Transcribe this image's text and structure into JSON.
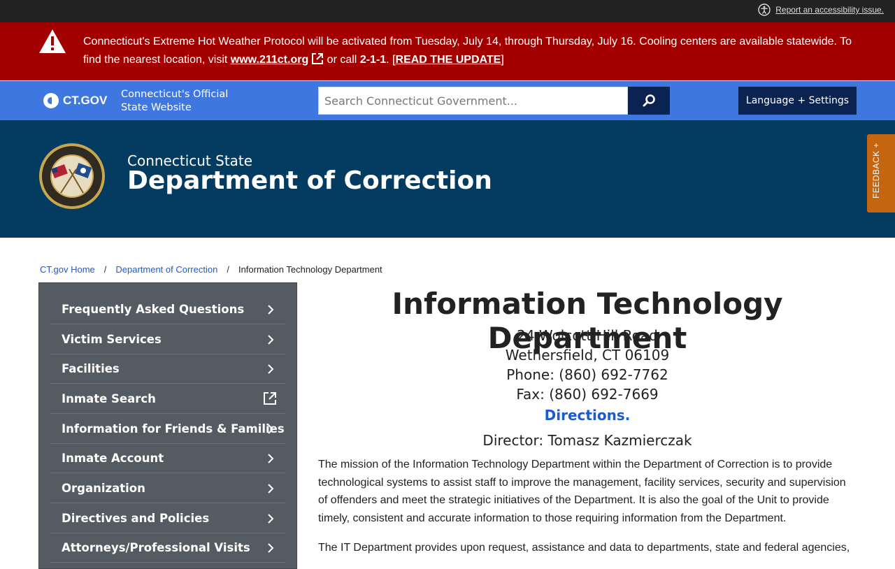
{
  "topbar": {
    "accessibility_link": "Report an accessibility issue."
  },
  "alert": {
    "text_before": "Connecticut's Extreme Hot Weather Protocol will be activated from Tuesday, July 14, through Thursday, July 16. Cooling centers are available statewide. To find the nearest location, visit ",
    "link": "www.211ct.org",
    "text_middle": " or call ",
    "phone": "2-1-1",
    "text_after": ". [",
    "update_link": "READ THE UPDATE",
    "text_end": "]"
  },
  "ctbar": {
    "logo": "CT.GOV",
    "official_line1": "Connecticut's Official",
    "official_line2": "State Website",
    "search_placeholder": "Search Connecticut Government...",
    "language_button": "Language + Settings"
  },
  "hero": {
    "subtitle": "Connecticut State",
    "title": "Department of Correction"
  },
  "feedback": "FEEDBACK +",
  "breadcrumb": [
    "CT.gov Home",
    "Department of Correction",
    "Information Technology Department"
  ],
  "sidenav": {
    "items": [
      {
        "label": "Frequently Asked Questions",
        "icon": "chevron-right-icon"
      },
      {
        "label": "Victim Services",
        "icon": "chevron-right-icon"
      },
      {
        "label": "Facilities",
        "icon": "chevron-right-icon"
      },
      {
        "label": "Inmate Search",
        "icon": "external-link-icon"
      },
      {
        "label": "Information for Friends & Families",
        "icon": "chevron-right-icon"
      },
      {
        "label": "Inmate Account",
        "icon": "chevron-right-icon"
      },
      {
        "label": "Organization",
        "icon": "chevron-right-icon"
      },
      {
        "label": "Directives and Policies",
        "icon": "chevron-right-icon"
      },
      {
        "label": "Attorneys/Professional Visits",
        "icon": "chevron-right-icon"
      }
    ]
  },
  "main": {
    "title": "Information Technology Department",
    "address_line1": "24 Wolcott Hill Road",
    "address_line2": "Wethersfield, CT 06109",
    "phone": "Phone: (860) 692-7762",
    "fax": "Fax: (860) 692-7669",
    "directions": "Directions.",
    "director": "Director: Tomasz Kazmierczak",
    "paragraph1": "The mission of the Information Technology Department within the Department of Correction is to provide technological systems to assist staff to improve the management, facility services, security and supervision of offenders and meet the strategic initiatives of the Department. It is also the goal of the Unit to provide timely, consistent and accurate information to those requiring information from the Department.",
    "paragraph2": "The IT Department provides upon request, assistance and data to departments, state and federal agencies,"
  },
  "colors": {
    "alert_bg": "#a30000",
    "ctbar_bg": "#3f77e0",
    "hero_bg": "#043b61",
    "sidenav_bg": "#545b63",
    "feedback_bg": "#c5660e",
    "link": "#1b5bd0"
  }
}
